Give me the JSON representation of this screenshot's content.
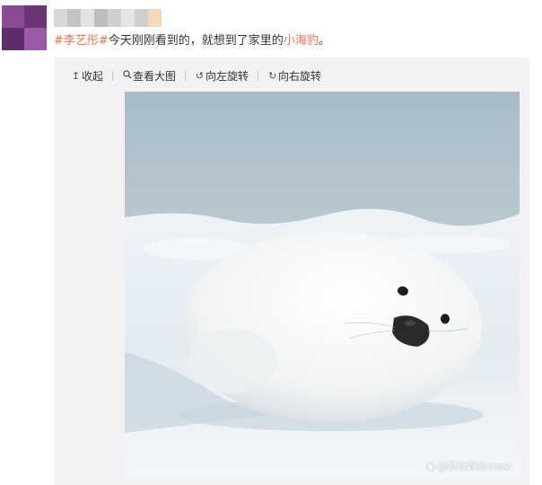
{
  "post": {
    "hashtag": "#李艺彤#",
    "text_before": "今天刚刚看到的，就想到了家里的",
    "highlight": "小海豹",
    "text_after": "。"
  },
  "toolbar": {
    "collapse_label": "收起",
    "view_large_label": "查看大图",
    "rotate_left_label": "向左旋转",
    "rotate_right_label": "向右旋转"
  },
  "photo": {
    "watermark": "@鞭攻鞭命snow"
  },
  "colors": {
    "link": "#eb7350",
    "panel_bg": "#f2f2f5"
  }
}
